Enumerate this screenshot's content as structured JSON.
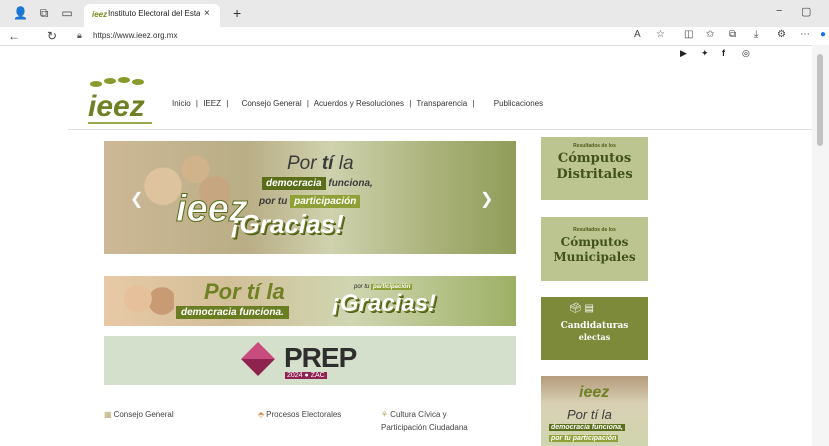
{
  "browser": {
    "tab_title": "Instituto Electoral del Estado de",
    "tab_close": "×",
    "new_tab": "+",
    "url": "https://www.ieez.org.mx",
    "window_minimize": "−",
    "window_maximize": "▢"
  },
  "header": {
    "logo_text": "ieez",
    "nav": {
      "inicio": "Inicio",
      "sep": "|",
      "ieez": "IEEZ",
      "consejo": "Consejo General",
      "acuerdos": "Acuerdos y Resoluciones",
      "transparencia": "Transparencia",
      "publicaciones": "Publicaciones"
    }
  },
  "hero": {
    "line1a": "Por ",
    "line1b": "tí",
    "line1c": " la",
    "dem1": "democracia",
    "dem2": " funciona,",
    "por_tu": "por tu ",
    "participacion": "participación",
    "gracias": "¡Gracias!"
  },
  "banner2": {
    "por": "Por tí la",
    "dem": "democracia funciona.",
    "por_tu": "por tu ",
    "participacion": "participación",
    "gracias": "¡Gracias!"
  },
  "prep": {
    "title": "PREP",
    "year": "2024 ● ZAC"
  },
  "footer_links": {
    "consejo": "Consejo General",
    "procesos": "Procesos Electorales",
    "cultura1": "Cultura Cívica y",
    "cultura2": "Participación Ciudadana"
  },
  "sidebar": {
    "card1": {
      "small": "Resultados de los",
      "big1": "Cómputos",
      "big2": "Distritales"
    },
    "card2": {
      "small": "Resultados de los",
      "big1": "Cómputos",
      "big2": "Municipales"
    },
    "card3": {
      "big1": "Candidaturas",
      "big2": "electas"
    },
    "card4": {
      "logo": "ieez",
      "por": "Por tí la",
      "dem": "democracia funciona,",
      "por_tu": "por tu participación"
    }
  },
  "colors": {
    "brand_green": "#6f8124",
    "prep_magenta": "#8e2350"
  }
}
